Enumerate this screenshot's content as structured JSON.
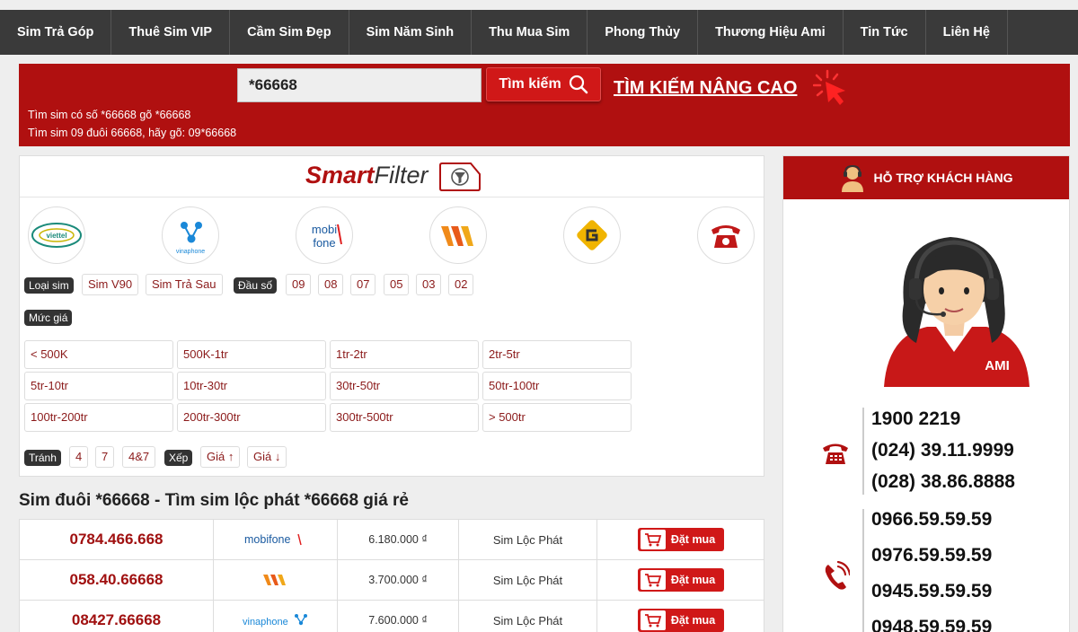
{
  "nav": [
    {
      "label": "Sim Trả Góp"
    },
    {
      "label": "Thuê Sim VIP"
    },
    {
      "label": "Cầm Sim Đẹp"
    },
    {
      "label": "Sim Năm Sinh"
    },
    {
      "label": "Thu Mua Sim"
    },
    {
      "label": "Phong Thủy"
    },
    {
      "label": "Thương Hiệu Ami"
    },
    {
      "label": "Tin Tức"
    },
    {
      "label": "Liên Hệ"
    }
  ],
  "search": {
    "value": "*66668",
    "button_label": "Tìm kiếm",
    "advanced_label": "TÌM KIẾM NÂNG CAO",
    "hint_1": "Tìm sim có số *66668 gõ *66668",
    "hint_2": "Tìm sim 09 đuôi 66668, hãy gõ: 09*66668"
  },
  "smart_filter": {
    "title_smart": "Smart",
    "title_filter": "Filter",
    "networks": [
      {
        "name": "Viettel",
        "icon": "viettel-logo",
        "color": "#1a8a7a"
      },
      {
        "name": "Vinaphone",
        "icon": "vinaphone-logo",
        "color": "#1a88d8"
      },
      {
        "name": "Mobifone",
        "icon": "mobifone-logo",
        "color": "#1a5aa0"
      },
      {
        "name": "Vietnamobile",
        "icon": "vietnamobile-logo",
        "color": "#f08a1a"
      },
      {
        "name": "Gmobile",
        "icon": "gmobile-logo",
        "color": "#f0b400"
      },
      {
        "name": "Máy bàn",
        "icon": "telephone-logo",
        "color": "#c01818"
      }
    ],
    "type_label": "Loại sim",
    "types": [
      "Sim V90",
      "Sim Trả Sau"
    ],
    "prefix_label": "Đầu số",
    "prefixes": [
      "09",
      "08",
      "07",
      "05",
      "03",
      "02"
    ],
    "price_label": "Mức giá",
    "prices": [
      "< 500K",
      "500K-1tr",
      "1tr-2tr",
      "2tr-5tr",
      "5tr-10tr",
      "10tr-30tr",
      "30tr-50tr",
      "50tr-100tr",
      "100tr-200tr",
      "200tr-300tr",
      "300tr-500tr",
      "> 500tr"
    ],
    "avoid_label": "Tránh",
    "avoid": [
      "4",
      "7",
      "4&7"
    ],
    "sort_label": "Xếp",
    "sorts": [
      "Giá ↑",
      "Giá ↓"
    ]
  },
  "listing": {
    "title": "Sim đuôi *66668 - Tìm sim lộc phát *66668 giá rẻ",
    "buy_label": "Đặt mua",
    "rows": [
      {
        "number": "0784.466.668",
        "network": "mobifone",
        "price": "6.180.000 ₫",
        "type": "Sim Lộc Phát"
      },
      {
        "number": "058.40.66668",
        "network": "vietnamobile",
        "price": "3.700.000 ₫",
        "type": "Sim Lộc Phát"
      },
      {
        "number": "08427.66668",
        "network": "vinaphone",
        "price": "7.600.000 ₫",
        "type": "Sim Lộc Phát"
      }
    ]
  },
  "support": {
    "title": "HỖ TRỢ KHÁCH HÀNG",
    "landlines": [
      "1900 2219",
      "(024) 39.11.9999",
      "(028) 38.86.8888"
    ],
    "mobiles": [
      "0966.59.59.59",
      "0976.59.59.59",
      "0945.59.59.59",
      "0948.59.59.59"
    ],
    "brand": "AMI"
  },
  "colors": {
    "primary_red": "#b01010",
    "nav_dark": "#3a3a3a",
    "number_red": "#a01010"
  }
}
